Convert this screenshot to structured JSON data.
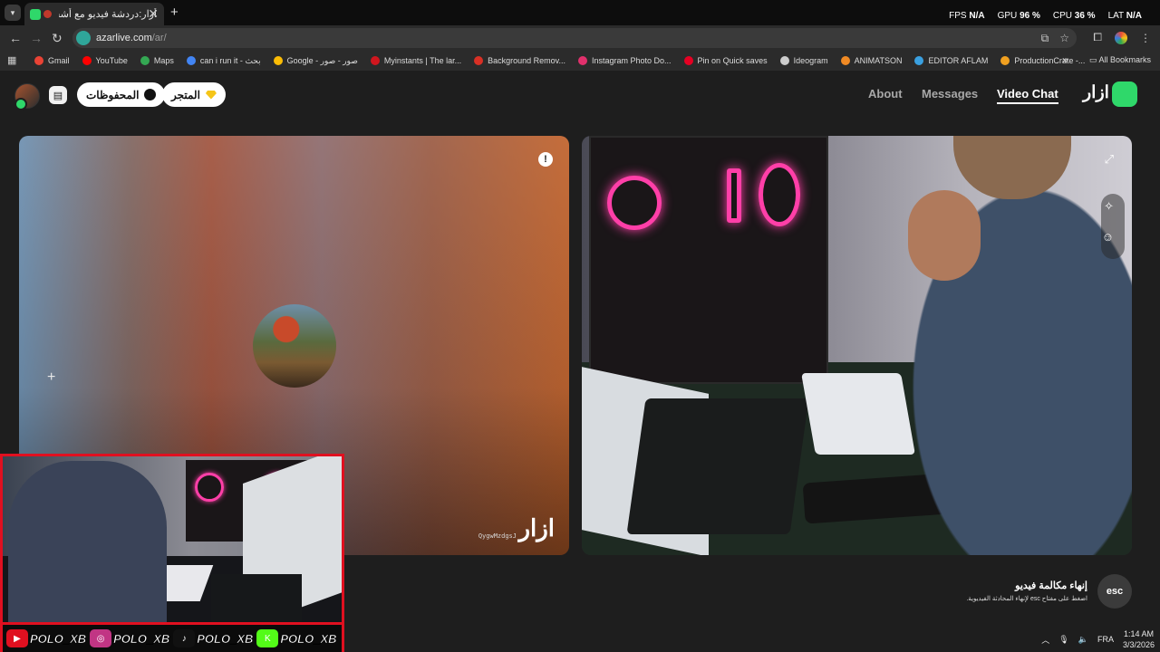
{
  "browser": {
    "tab": {
      "title": "أزار:دردشة فيديو مع أشخاص",
      "close": "✕"
    },
    "new_tab": "+",
    "perf": [
      {
        "label": "FPS",
        "value": "N/A"
      },
      {
        "label": "GPU",
        "value": "96 %"
      },
      {
        "label": "CPU",
        "value": "36 %"
      },
      {
        "label": "LAT",
        "value": "N/A"
      }
    ],
    "url": {
      "host": "azarlive.com",
      "path": "/ar/"
    },
    "bookmarks": [
      {
        "label": "Gmail",
        "color": "#ea4335"
      },
      {
        "label": "YouTube",
        "color": "#ff0000"
      },
      {
        "label": "Maps",
        "color": "#34a853"
      },
      {
        "label": "can i run it - بحث",
        "color": "#4285f4"
      },
      {
        "label": "Google - صور - صور",
        "color": "#fbbc05"
      },
      {
        "label": "Myinstants | The lar...",
        "color": "#d0161e"
      },
      {
        "label": "Background Remov...",
        "color": "#d93025"
      },
      {
        "label": "Instagram Photo Do...",
        "color": "#e1306c"
      },
      {
        "label": "Pin on Quick saves",
        "color": "#e60023"
      },
      {
        "label": "Ideogram",
        "color": "#cccccc"
      },
      {
        "label": "ANIMATSON",
        "color": "#f08a24"
      },
      {
        "label": "EDITOR AFLAM",
        "color": "#3aa0e0"
      },
      {
        "label": "ProductionCrate -...",
        "color": "#f0a020"
      }
    ],
    "bookmarks_more": "»",
    "all_bookmarks": "All Bookmarks"
  },
  "header": {
    "saved_label": "المحفوظات",
    "store_label": "المتجر",
    "nav": [
      {
        "label": "About",
        "active": false
      },
      {
        "label": "Messages",
        "active": false
      },
      {
        "label": "Video Chat",
        "active": true
      }
    ],
    "brand": "ازار"
  },
  "partner_panel": {
    "watermark": "ازار",
    "user_id": "QygwMzdgsJ",
    "report_icon": "!"
  },
  "footer": {
    "end_title": "إنهاء مكالمة فيديو",
    "end_hint": "اضغط على مفتاح esc لإنهاء المحادثة الفيديوية.",
    "esc_label": "esc"
  },
  "overlay": {
    "socials": [
      {
        "icon": "youtube-icon",
        "handle": "POLO_XB",
        "color": "#e01020"
      },
      {
        "icon": "instagram-icon",
        "handle": "POLO_XB",
        "color": "#c13584"
      },
      {
        "icon": "tiktok-icon",
        "handle": "POLO_XB",
        "color": "#111111"
      },
      {
        "icon": "kick-icon",
        "handle": "POLO_XB",
        "color": "#53fc18"
      }
    ]
  },
  "taskbar": {
    "language": "FRA",
    "time": "1:14 AM",
    "date": "3/3/2026"
  }
}
